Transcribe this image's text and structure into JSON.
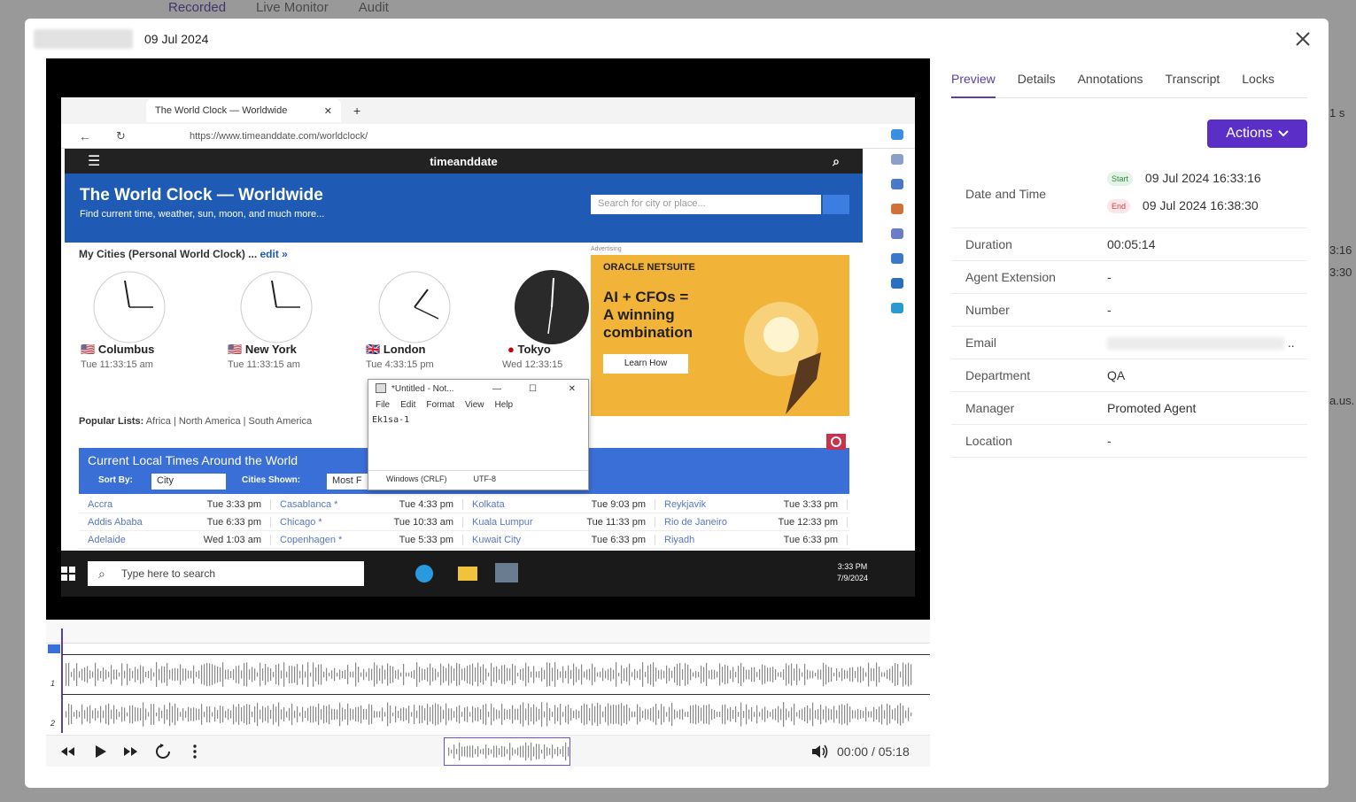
{
  "background": {
    "tabs": [
      "Recorded",
      "Live Monitor",
      "Audit"
    ],
    "active_tab": "Recorded",
    "right_fragments": [
      "1 s",
      "3:16",
      "3:30",
      "a.us."
    ]
  },
  "modal": {
    "date": "09 Jul 2024"
  },
  "video": {
    "browser_tab_title": "The World Clock — Worldwide",
    "url": "https://www.timeanddate.com/worldclock/",
    "site_name": "timeanddate",
    "hero_title": "The World Clock — Worldwide",
    "hero_subtitle": "Find current time, weather, sun, moon, and much more...",
    "search_placeholder": "Search for city or place...",
    "my_cities_label": "My Cities (Personal World Clock) ...",
    "edit_label": "edit »",
    "cities": [
      {
        "name": "Columbus",
        "time": "Tue 11:33:15 am"
      },
      {
        "name": "New York",
        "time": "Tue 11:33:15 am"
      },
      {
        "name": "London",
        "time": "Tue 4:33:15 pm"
      },
      {
        "name": "Tokyo",
        "time": "Wed 12:33:15"
      }
    ],
    "ad": {
      "label": "Advertising",
      "brand": "ORACLE NETSUITE",
      "line1": "AI + CFOs =",
      "line2": "A winning",
      "line3": "combination",
      "cta": "Learn How"
    },
    "popular_label": "Popular Lists:",
    "popular_items": "Africa | North America | South America",
    "notepad": {
      "title": "*Untitled - Not...",
      "menu": [
        "File",
        "Edit",
        "Format",
        "View",
        "Help"
      ],
      "text": "Ek1sa-1",
      "status_eol": "Windows (CRLF)",
      "status_enc": "UTF-8"
    },
    "local_times": {
      "title": "Current Local Times Around the World",
      "sort_label": "Sort By:",
      "sort_value": "City",
      "shown_label": "Cities Shown:",
      "shown_value": "Most F",
      "rows": [
        [
          [
            "Accra",
            "Tue 3:33 pm"
          ],
          [
            "Casablanca *",
            "Tue 4:33 pm"
          ],
          [
            "Kolkata",
            "Tue 9:03 pm"
          ],
          [
            "Reykjavik",
            "Tue 3:33 pm"
          ]
        ],
        [
          [
            "Addis Ababa",
            "Tue 6:33 pm"
          ],
          [
            "Chicago *",
            "Tue 10:33 am"
          ],
          [
            "Kuala Lumpur",
            "Tue 11:33 pm"
          ],
          [
            "Rio de Janeiro",
            "Tue 12:33 pm"
          ]
        ],
        [
          [
            "Adelaide",
            "Wed 1:03 am"
          ],
          [
            "Copenhagen *",
            "Tue 5:33 pm"
          ],
          [
            "Kuwait City",
            "Tue 6:33 pm"
          ],
          [
            "Riyadh",
            "Tue 6:33 pm"
          ]
        ]
      ]
    },
    "taskbar": {
      "search": "Type here to search",
      "time": "3:33 PM",
      "date": "7/9/2024"
    }
  },
  "player": {
    "tracks": [
      "1",
      "2"
    ],
    "current": "00:00",
    "total": "05:18",
    "separator": "/"
  },
  "tabs": [
    "Preview",
    "Details",
    "Annotations",
    "Transcript",
    "Locks"
  ],
  "active_tab": "Preview",
  "actions_label": "Actions",
  "details": {
    "date_time_label": "Date and Time",
    "start_badge": "Start",
    "start_value": "09 Jul 2024 16:33:16",
    "end_badge": "End",
    "end_value": "09 Jul 2024 16:38:30",
    "rows": [
      {
        "label": "Duration",
        "value": "00:05:14"
      },
      {
        "label": "Agent Extension",
        "value": "-"
      },
      {
        "label": "Number",
        "value": "-"
      },
      {
        "label": "Email",
        "value": ".."
      },
      {
        "label": "Department",
        "value": "QA"
      },
      {
        "label": "Manager",
        "value": "Promoted Agent"
      },
      {
        "label": "Location",
        "value": "-"
      }
    ]
  },
  "colors": {
    "accent": "#5a3ea8",
    "actions_bg": "#5b2fc7",
    "start_badge": "#2f8b46",
    "end_badge": "#c24747"
  }
}
